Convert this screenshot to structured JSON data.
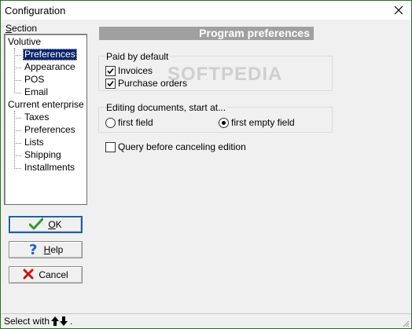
{
  "window": {
    "title": "Configuration"
  },
  "section": {
    "label_acc": "S",
    "label_rest": "ection"
  },
  "tree": {
    "root1": "Volutive",
    "root1_children": [
      "Preferences",
      "Appearance",
      "POS",
      "Email"
    ],
    "root2": "Current enterprise",
    "root2_children": [
      "Taxes",
      "Preferences",
      "Lists",
      "Shipping",
      "Installments"
    ],
    "selected": "Preferences"
  },
  "buttons": {
    "ok_acc": "O",
    "ok_rest": "K",
    "help_acc": "H",
    "help_rest": "elp",
    "cancel": "Cancel"
  },
  "pane": {
    "header": "Program preferences",
    "paid_group": "Paid by default",
    "invoices": "Invoices",
    "invoices_checked": true,
    "purchase_orders": "Purchase orders",
    "purchase_orders_checked": true,
    "editing_group": "Editing documents, start at...",
    "first_field": "first field",
    "first_empty_field": "first empty field",
    "editing_selected": "first empty field",
    "query_cancel": "Query before canceling edition",
    "query_cancel_checked": false
  },
  "watermark": "SOFTPEDIA",
  "status": {
    "text": "Select with",
    "suffix": "."
  },
  "colors": {
    "selection": "#0a246a",
    "header_bg": "#a0a0a0",
    "ok_icon": "#2e9a2e",
    "help_icon": "#1c5fd0",
    "cancel_icon": "#c81414",
    "window_border": "#1d7a1d"
  }
}
